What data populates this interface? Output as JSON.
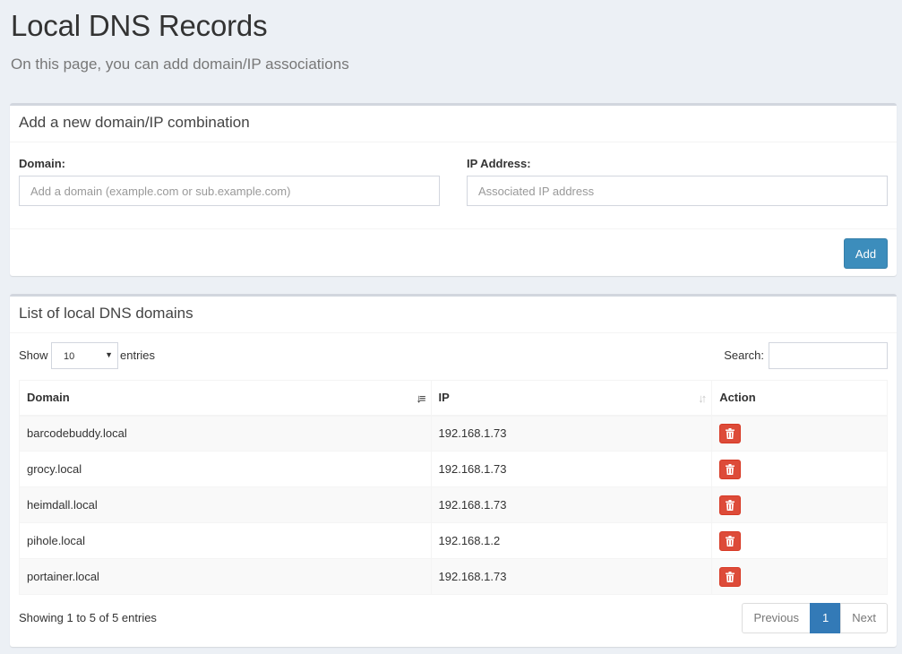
{
  "header": {
    "title": "Local DNS Records",
    "subtitle": "On this page, you can add domain/IP associations"
  },
  "form": {
    "title": "Add a new domain/IP combination",
    "domain_label": "Domain:",
    "domain_placeholder": "Add a domain (example.com or sub.example.com)",
    "ip_label": "IP Address:",
    "ip_placeholder": "Associated IP address",
    "add_label": "Add"
  },
  "list": {
    "title": "List of local DNS domains",
    "show_label": "Show",
    "entries_value": "10",
    "entries_label": "entries",
    "search_label": "Search:",
    "columns": [
      "Domain",
      "IP",
      "Action"
    ],
    "rows": [
      {
        "domain": "barcodebuddy.local",
        "ip": "192.168.1.73"
      },
      {
        "domain": "grocy.local",
        "ip": "192.168.1.73"
      },
      {
        "domain": "heimdall.local",
        "ip": "192.168.1.73"
      },
      {
        "domain": "pihole.local",
        "ip": "192.168.1.2"
      },
      {
        "domain": "portainer.local",
        "ip": "192.168.1.73"
      }
    ],
    "info": "Showing 1 to 5 of 5 entries",
    "pagination": {
      "previous": "Previous",
      "current": "1",
      "next": "Next"
    }
  },
  "icons": {
    "sort_asc": "sort-amount-asc-icon",
    "sort_both": "sort-both-icon",
    "delete": "trash-icon"
  },
  "colors": {
    "primary": "#3c8dbc",
    "danger": "#dd4b39",
    "page_active": "#337ab7",
    "background": "#ecf0f5"
  }
}
